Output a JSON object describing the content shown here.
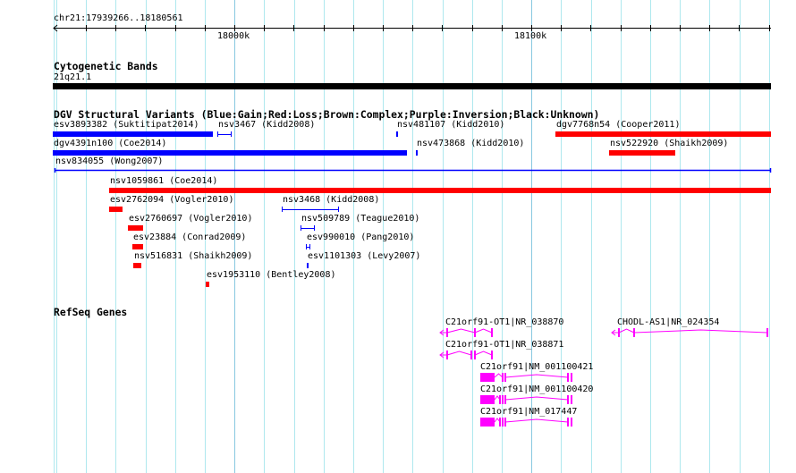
{
  "ruler": {
    "location": "chr21:17939266..18180561",
    "ticks": [
      "18000k",
      "18100k"
    ]
  },
  "tracks": {
    "cytoband": {
      "title": "Cytogenetic Bands",
      "band": "21q21.1",
      "color": "#000000"
    },
    "dgv": {
      "title": "DGV Structural Variants (Blue:Gain;Red:Loss;Brown:Complex;Purple:Inversion;Black:Unknown)",
      "colors": {
        "gain": "#0000ff",
        "loss": "#ff0000"
      },
      "features": [
        {
          "label": "esv3893382 (Suktitipat2014)",
          "type": "gain"
        },
        {
          "label": "nsv3467 (Kidd2008)",
          "type": "gain"
        },
        {
          "label": "nsv481107 (Kidd2010)",
          "type": "gain"
        },
        {
          "label": "dgv7768n54 (Cooper2011)",
          "type": "loss"
        },
        {
          "label": "dgv4391n100 (Coe2014)",
          "type": "gain"
        },
        {
          "label": "nsv473868 (Kidd2010)",
          "type": "gain"
        },
        {
          "label": "nsv522920 (Shaikh2009)",
          "type": "loss"
        },
        {
          "label": "nsv834055 (Wong2007)",
          "type": "gain"
        },
        {
          "label": "nsv1059861 (Coe2014)",
          "type": "loss"
        },
        {
          "label": "esv2762094 (Vogler2010)",
          "type": "loss"
        },
        {
          "label": "nsv3468 (Kidd2008)",
          "type": "gain"
        },
        {
          "label": "esv2760697 (Vogler2010)",
          "type": "loss"
        },
        {
          "label": "nsv509789 (Teague2010)",
          "type": "gain"
        },
        {
          "label": "esv23884 (Conrad2009)",
          "type": "loss"
        },
        {
          "label": "esv990010 (Pang2010)",
          "type": "gain"
        },
        {
          "label": "nsv516831 (Shaikh2009)",
          "type": "loss"
        },
        {
          "label": "esv1101303 (Levy2007)",
          "type": "gain"
        },
        {
          "label": "esv1953110 (Bentley2008)",
          "type": "loss"
        }
      ]
    },
    "refseq": {
      "title": "RefSeq Genes",
      "color": "#ff00ff",
      "genes": [
        {
          "label": "C21orf91-OT1|NR_038870",
          "strand": "-"
        },
        {
          "label": "CHODL-AS1|NR_024354",
          "strand": "-"
        },
        {
          "label": "C21orf91-OT1|NR_038871",
          "strand": "-"
        },
        {
          "label": "C21orf91|NM_001100421",
          "strand": "-"
        },
        {
          "label": "C21orf91|NM_001100420",
          "strand": "-"
        },
        {
          "label": "C21orf91|NM_017447",
          "strand": "-"
        }
      ]
    }
  }
}
